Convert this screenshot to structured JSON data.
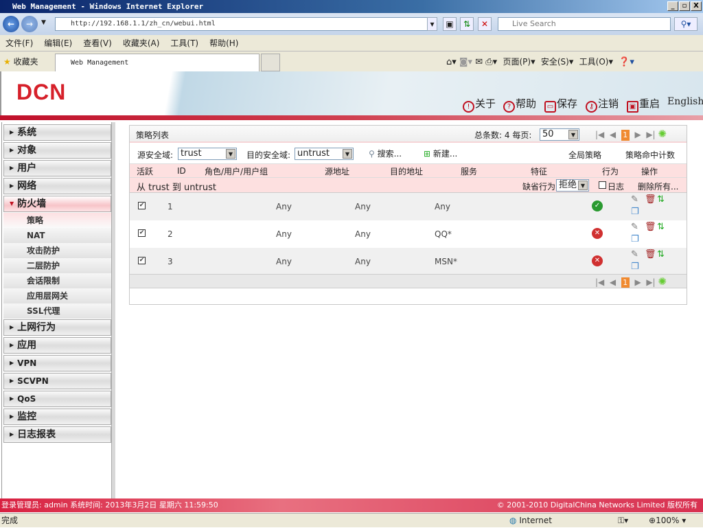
{
  "window": {
    "title": "Web Management - Windows Internet Explorer",
    "min": "_",
    "max": "▫",
    "close": "X"
  },
  "address": {
    "url": "http://192.168.1.1/zh_cn/webui.html",
    "search_placeholder": "Live Search"
  },
  "menu": [
    "文件(F)",
    "编辑(E)",
    "查看(V)",
    "收藏夹(A)",
    "工具(T)",
    "帮助(H)"
  ],
  "favbar": {
    "favorites": "收藏夹",
    "tab": "Web Management",
    "page": "页面(P)",
    "safety": "安全(S)",
    "tools": "工具(O)"
  },
  "header": {
    "logo": "DCN",
    "links": {
      "about": "关于",
      "help": "帮助",
      "save": "保存",
      "logout": "注销",
      "reboot": "重启",
      "english": "English"
    }
  },
  "sidebar": {
    "items": [
      "系统",
      "对象",
      "用户",
      "网络",
      "防火墙"
    ],
    "firewall_sub": [
      "策略",
      "NAT",
      "攻击防护",
      "二层防护",
      "会话限制",
      "应用层网关",
      "SSL代理"
    ],
    "items2": [
      "上网行为",
      "应用",
      "VPN",
      "SCVPN",
      "QoS",
      "监控",
      "日志报表"
    ]
  },
  "panel": {
    "title": "策略列表",
    "total_label": "总条数:",
    "total": "4",
    "per_page_label": "每页:",
    "per_page": "50",
    "page": "1",
    "src_zone_label": "源安全域:",
    "src_zone": "trust",
    "dst_zone_label": "目的安全域:",
    "dst_zone": "untrust",
    "search": "搜索...",
    "new": "新建...",
    "global_policy": "全局策略",
    "hit_count": "策略命中计数",
    "columns": [
      "活跃",
      "ID",
      "角色/用户/用户组",
      "源地址",
      "目的地址",
      "服务",
      "特征",
      "行为",
      "操作"
    ],
    "group": "从 trust 到 untrust",
    "default_action_label": "缺省行为",
    "default_action": "拒绝",
    "log": "日志",
    "delete_all": "删除所有...",
    "rows": [
      {
        "active": true,
        "id": "1",
        "src": "Any",
        "dst": "Any",
        "service": "Any",
        "action": "permit"
      },
      {
        "active": true,
        "id": "2",
        "src": "Any",
        "dst": "Any",
        "service": "QQ*",
        "action": "deny"
      },
      {
        "active": true,
        "id": "3",
        "src": "Any",
        "dst": "Any",
        "service": "MSN*",
        "action": "deny"
      }
    ]
  },
  "footer": {
    "left": "登录管理员: admin 系统时间: 2013年3月2日 星期六 11:59:50",
    "right": "© 2001-2010 DigitalChina Networks Limited 版权所有"
  },
  "statusbar": {
    "status": "完成",
    "zone": "Internet",
    "zoom": "100%"
  }
}
